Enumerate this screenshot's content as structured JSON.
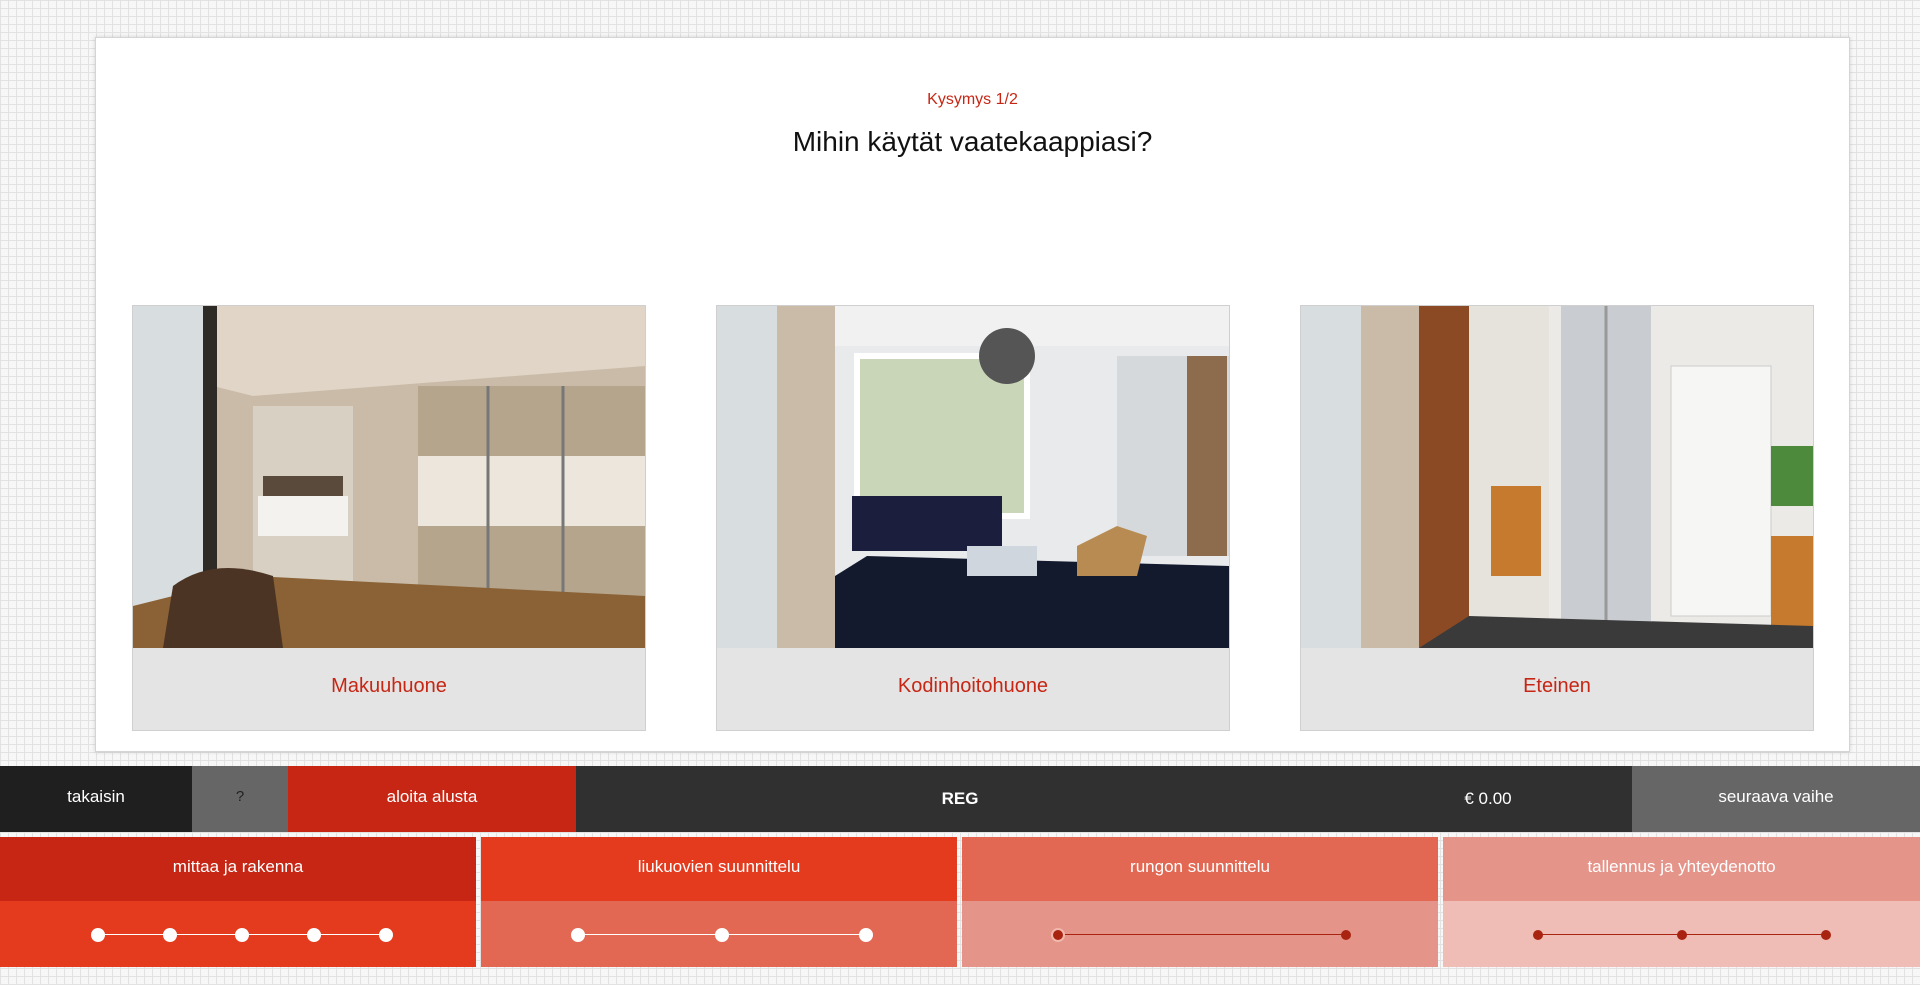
{
  "question": {
    "number": "Kysymys 1/2",
    "title": "Mihin käytät vaatekaappiasi?"
  },
  "options": [
    {
      "label": "Makuuhuone"
    },
    {
      "label": "Kodinhoitohuone"
    },
    {
      "label": "Eteinen"
    }
  ],
  "toolbar": {
    "back_label": "takaisin",
    "help_label": "?",
    "restart_label": "aloita alusta",
    "brand_label": "REG",
    "price_label": "€ 0.00",
    "next_label": "seuraava vaihe"
  },
  "phases": [
    {
      "title": "mittaa ja rakenna",
      "steps": 5
    },
    {
      "title": "liukuovien suunnittelu",
      "steps": 3
    },
    {
      "title": "rungon suunnittelu",
      "steps": 2
    },
    {
      "title": "tallennus ja yhteydenotto",
      "steps": 3
    }
  ],
  "colors": {
    "accent": "#c72614",
    "toolbar": "#303030"
  }
}
